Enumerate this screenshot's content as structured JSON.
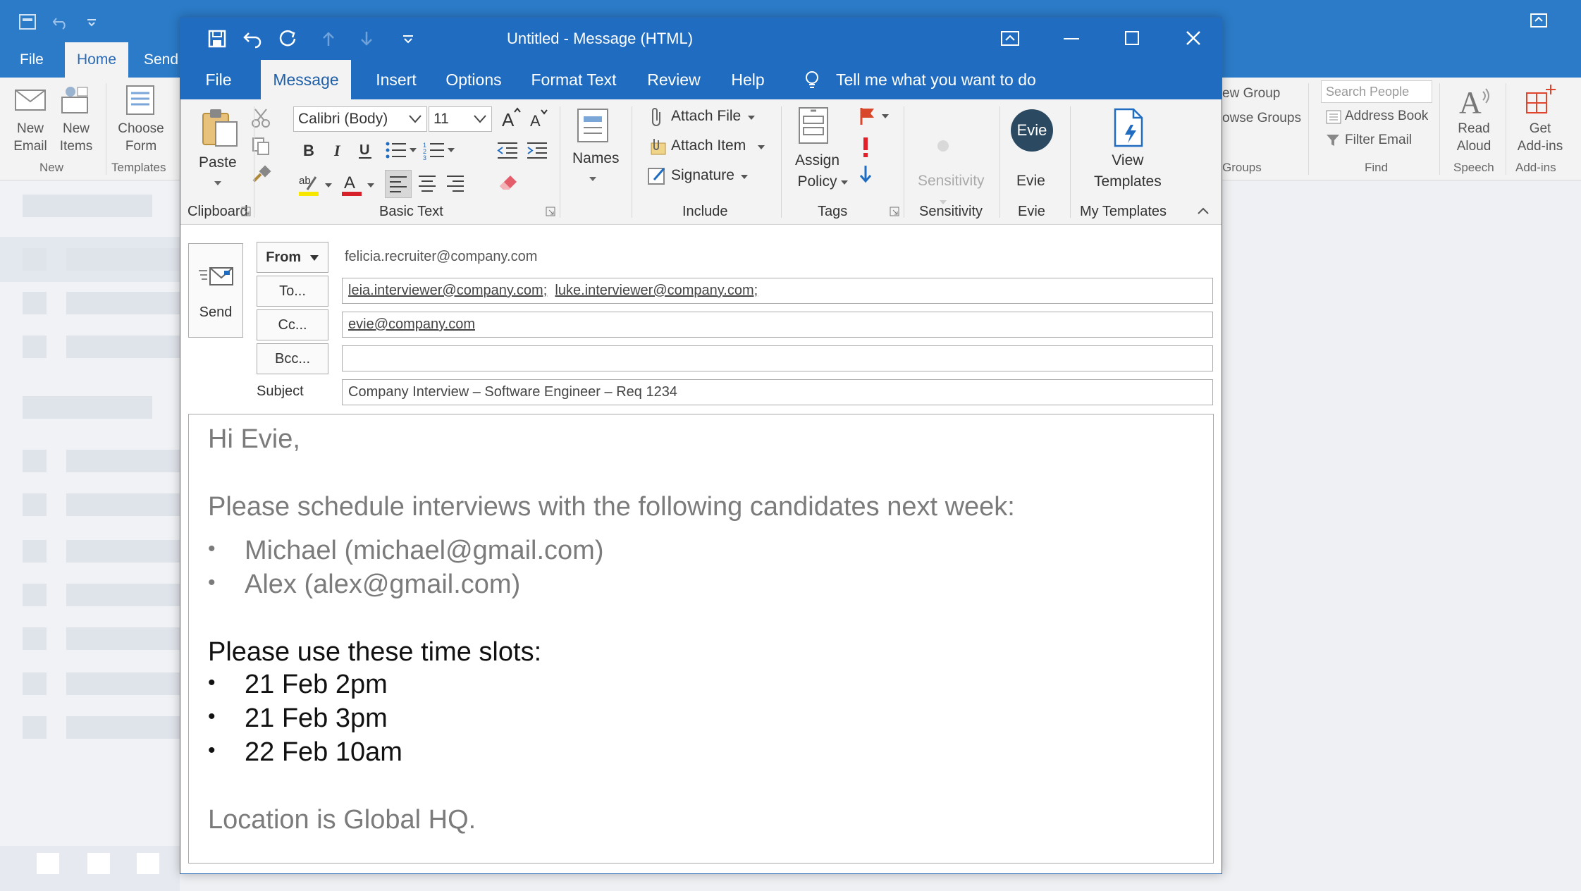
{
  "main_window": {
    "tabs": [
      "File",
      "Home",
      "Send"
    ],
    "commands": {
      "new_email": "New\nEmail",
      "new_items": "New\nItems",
      "choose_form": "Choose\nForm",
      "new_group": "ew Group",
      "browse_groups": "owse Groups",
      "search_people_placeholder": "Search People",
      "address_book": "Address Book",
      "filter_email": "Filter Email",
      "read_aloud": "Read\nAloud",
      "get_addins": "Get\nAdd-ins"
    },
    "groups": {
      "new": "New",
      "templates": "Templates",
      "groups": "Groups",
      "find": "Find",
      "speech": "Speech",
      "addins": "Add-ins"
    }
  },
  "compose": {
    "title": "Untitled  -  Message (HTML)",
    "tabs": [
      "File",
      "Message",
      "Insert",
      "Options",
      "Format Text",
      "Review",
      "Help"
    ],
    "tell_me": "Tell me what you want to do",
    "ribbon": {
      "paste": "Paste",
      "font_name": "Calibri (Body)",
      "font_size": "11",
      "names": "Names",
      "attach_file": "Attach File",
      "attach_item": "Attach Item",
      "signature": "Signature",
      "assign_policy": "Assign\nPolicy",
      "sensitivity": "Sensitivity",
      "evie_avatar": "Evie",
      "evie": "Evie",
      "view_templates": "View\nTemplates"
    },
    "groups": {
      "clipboard": "Clipboard",
      "basic_text": "Basic Text",
      "include": "Include",
      "tags": "Tags",
      "sensitivity": "Sensitivity",
      "evie": "Evie",
      "my_templates": "My Templates"
    },
    "header": {
      "send_label": "Send",
      "from_label": "From",
      "from_value": "felicia.recruiter@company.com",
      "to_label": "To...",
      "to_value": [
        "leia.interviewer@company.com;",
        "luke.interviewer@company.com;"
      ],
      "cc_label": "Cc...",
      "cc_value": "evie@company.com",
      "bcc_label": "Bcc...",
      "bcc_value": "",
      "subject_label": "Subject",
      "subject_value": "Company Interview – Software Engineer – Req 1234"
    },
    "body": {
      "greeting": "Hi Evie,",
      "intro": "Please schedule interviews with the following candidates next week:",
      "candidates": [
        "Michael (michael@gmail.com)",
        "Alex (alex@gmail.com)"
      ],
      "slots_intro": "Please use these time slots:",
      "slots": [
        "21 Feb 2pm",
        "21 Feb 3pm",
        "22 Feb 10am"
      ],
      "location": "Location is Global HQ."
    }
  },
  "colors": {
    "title_blue": "#1f6cc0",
    "ribbon_bg": "#f3f3f3",
    "body_gray_text": "#7b7b7b",
    "body_black_text": "#111111",
    "font_color_red": "#d6202a",
    "highlight_yellow": "#f7e600",
    "flag_red": "#d9472b"
  }
}
